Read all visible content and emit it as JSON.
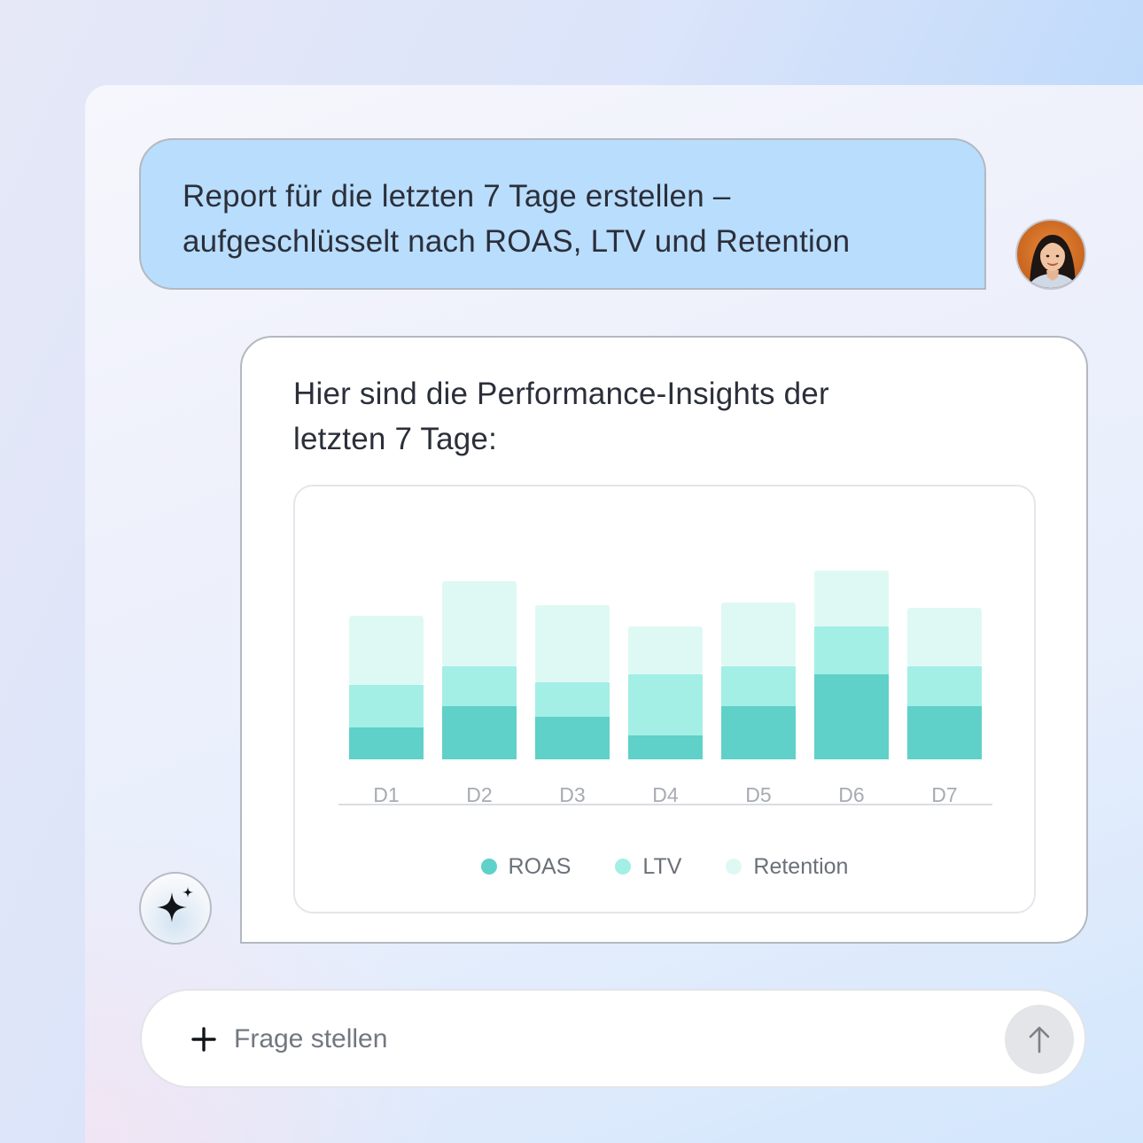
{
  "conversation": {
    "user_message": {
      "line1": "Report für die letzten 7 Tage erstellen –",
      "line2": "aufgeschlüsselt nach ROAS, LTV und Retention"
    },
    "assistant_message": {
      "line1": "Hier sind die Performance-Insights der",
      "line2": "letzten 7 Tage:"
    }
  },
  "composer": {
    "placeholder": "Frage stellen"
  },
  "icons": {
    "add": "plus-icon",
    "send": "arrow-up-icon",
    "assistant": "sparkle-icon",
    "user": "avatar"
  },
  "colors": {
    "roas": "#5fd1c9",
    "ltv": "#a3efe6",
    "retention": "#def9f3",
    "user_bubble": "#b9ddfd"
  },
  "chart_data": {
    "type": "bar",
    "stacked": true,
    "categories": [
      "D1",
      "D2",
      "D3",
      "D4",
      "D5",
      "D6",
      "D7"
    ],
    "series": [
      {
        "name": "ROAS",
        "color": "#5fd1c9",
        "values": [
          36,
          60,
          48,
          27,
          60,
          96,
          60
        ]
      },
      {
        "name": "LTV",
        "color": "#a3efe6",
        "values": [
          48,
          45,
          39,
          69,
          45,
          54,
          45
        ]
      },
      {
        "name": "Retention",
        "color": "#def9f3",
        "values": [
          78,
          96,
          87,
          54,
          72,
          63,
          66
        ]
      }
    ],
    "ylim": [
      0,
      220
    ],
    "grid": false,
    "legend_position": "bottom-center",
    "title": "",
    "xlabel": "",
    "ylabel": ""
  }
}
